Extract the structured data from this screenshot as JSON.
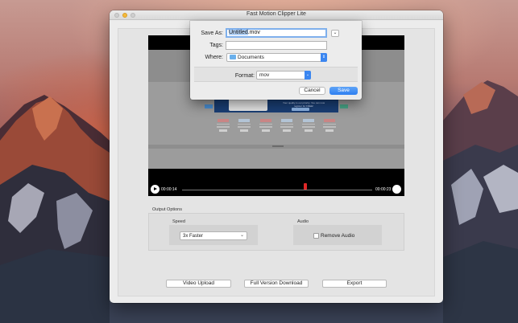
{
  "window": {
    "title": "Fast Motion Clipper Lite"
  },
  "player": {
    "current_time": "00:00:14",
    "end_time": "00:00:23",
    "playhead_position": 0.65,
    "video_content": {
      "header_text": "Your quality is our priority. You can now register for FREE!",
      "footer_link": "Back to top"
    }
  },
  "output_options": {
    "title": "Output Options",
    "speed": {
      "label": "Speed",
      "selected": "3x Faster"
    },
    "audio": {
      "label": "Audio",
      "checkbox_label": "Remove Audio",
      "checked": false
    }
  },
  "buttons": {
    "video_upload": "Video Upload",
    "full_version": "Full Version Download",
    "export": "Export"
  },
  "save_dialog": {
    "save_as_label": "Save As:",
    "filename_base": "Untitled",
    "filename_ext": ".mov",
    "tags_label": "Tags:",
    "tags_value": "",
    "where_label": "Where:",
    "where_value": "Documents",
    "format_label": "Format:",
    "format_value": "mov",
    "cancel_label": "Cancel",
    "save_label": "Save"
  },
  "colors": {
    "accent": "#3b86f0",
    "marker": "#e02727",
    "window_bg": "#ececec"
  },
  "icons": {
    "folder": "folder-icon",
    "play": "play-icon",
    "expand": "chevron-down-icon"
  }
}
